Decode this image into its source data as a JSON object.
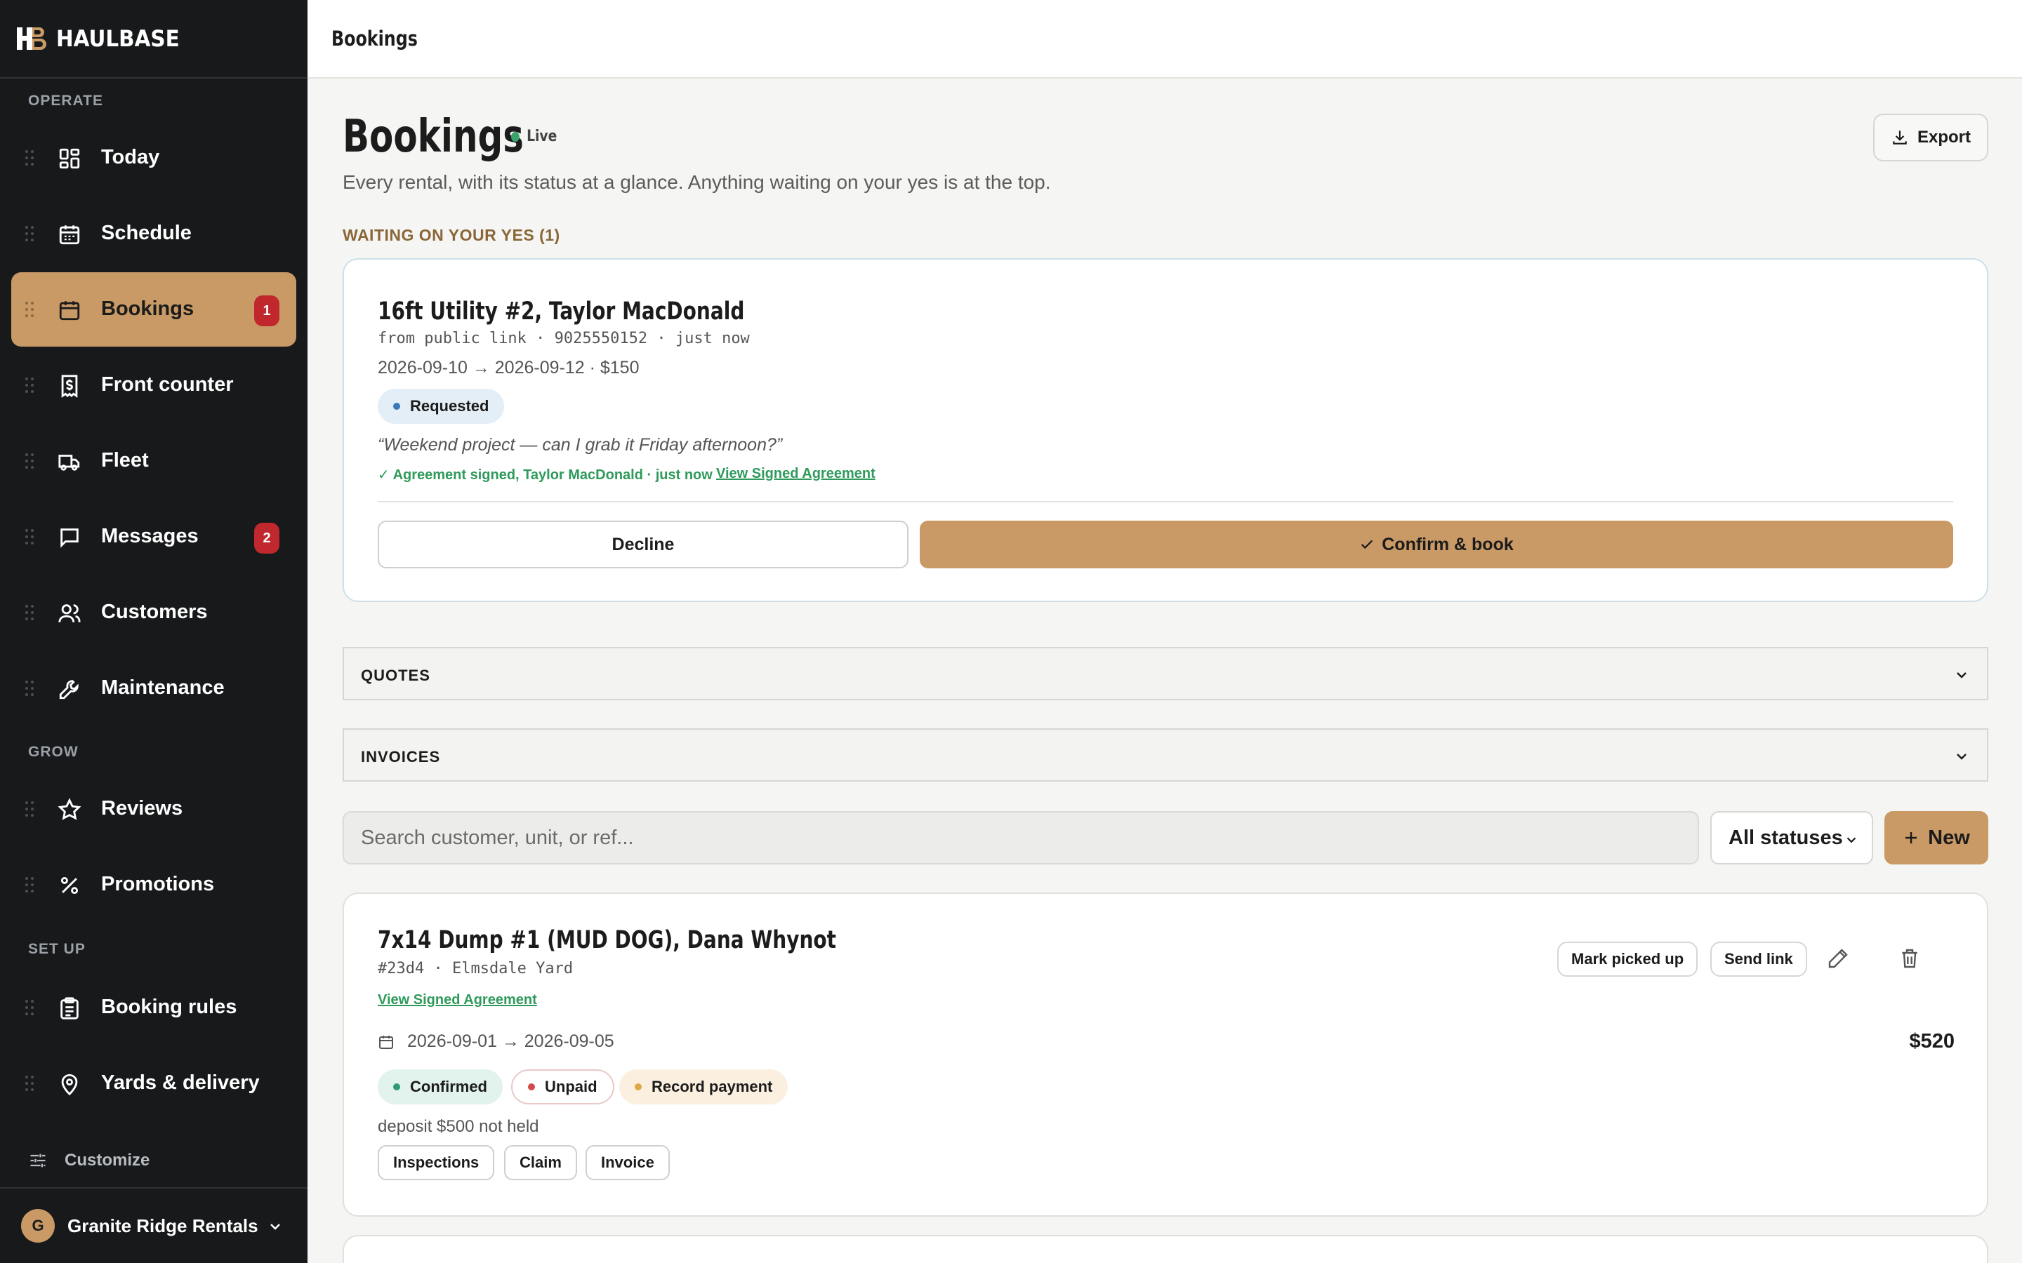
{
  "app": {
    "brand": "HAULBASE",
    "brand_colors": {
      "accent": "#c99a66",
      "sidebar": "#17191b",
      "danger": "#c0282d",
      "success": "#2f9a5b"
    }
  },
  "sidebar": {
    "sections": {
      "operate": "OPERATE",
      "grow": "GROW",
      "setup": "SET UP"
    },
    "items": [
      {
        "label": "Today",
        "icon": "dashboard-icon"
      },
      {
        "label": "Schedule",
        "icon": "calendar-grid-icon"
      },
      {
        "label": "Bookings",
        "icon": "calendar-icon",
        "badge": "1",
        "active": true
      },
      {
        "label": "Front counter",
        "icon": "dollar-receipt-icon"
      },
      {
        "label": "Fleet",
        "icon": "truck-icon"
      },
      {
        "label": "Messages",
        "icon": "message-icon",
        "badge": "2"
      },
      {
        "label": "Customers",
        "icon": "users-icon"
      },
      {
        "label": "Maintenance",
        "icon": "wrench-icon"
      },
      {
        "label": "Reviews",
        "icon": "star-icon"
      },
      {
        "label": "Promotions",
        "icon": "percent-icon"
      },
      {
        "label": "Booking rules",
        "icon": "clipboard-icon"
      },
      {
        "label": "Yards & delivery",
        "icon": "map-pin-icon"
      }
    ],
    "customize": "Customize",
    "org": {
      "initial": "G",
      "name": "Granite Ridge Rentals"
    }
  },
  "topbar": {
    "title": "Bookings"
  },
  "page": {
    "title": "Bookings",
    "live": "Live",
    "subtitle": "Every rental, with its status at a glance. Anything waiting on your yes is at the top.",
    "export": "Export",
    "waiting_label": "WAITING ON YOUR YES (1)"
  },
  "request": {
    "title": "16ft Utility #2, Taylor MacDonald",
    "meta": "from public link · 9025550152 · just now",
    "dates": "2026-09-10 → 2026-09-12 · $150",
    "status": "Requested",
    "quote": "“Weekend project — can I grab it Friday afternoon?”",
    "signed": "✓ Agreement signed, Taylor MacDonald · just now",
    "link": "View Signed Agreement",
    "decline": "Decline",
    "confirm": "Confirm & book"
  },
  "sections": {
    "quotes": "QUOTES",
    "invoices": "INVOICES"
  },
  "filters": {
    "search_placeholder": "Search customer, unit, or ref...",
    "status": "All statuses",
    "new": "New"
  },
  "booking": {
    "title": "7x14 Dump #1 (MUD DOG), Dana Whynot",
    "meta": "#23d4 · Elmsdale Yard",
    "link": "View Signed Agreement",
    "dates": "2026-09-01 → 2026-09-05",
    "price": "$520",
    "actions": {
      "picked_up": "Mark picked up",
      "send_link": "Send link"
    },
    "pills": {
      "confirmed": "Confirmed",
      "unpaid": "Unpaid",
      "record": "Record payment"
    },
    "deposit": "deposit $500 not held",
    "buttons": {
      "inspections": "Inspections",
      "claim": "Claim",
      "invoice": "Invoice"
    }
  }
}
